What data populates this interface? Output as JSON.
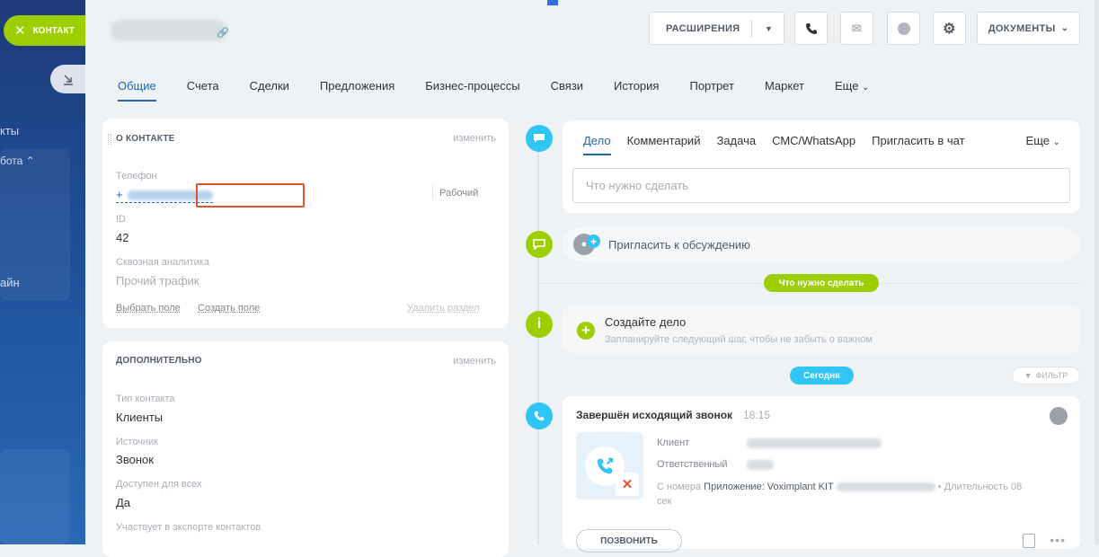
{
  "sidebar": {
    "chip_label": "КОНТАКТ",
    "partial_items": [
      "кты",
      "бота",
      "айн"
    ]
  },
  "header": {
    "extensions_label": "РАСШИРЕНИЯ",
    "documents_label": "ДОКУМЕНТЫ"
  },
  "tabs": [
    "Общие",
    "Счета",
    "Сделки",
    "Предложения",
    "Бизнес-процессы",
    "Связи",
    "История",
    "Портрет",
    "Маркет",
    "Еще"
  ],
  "about": {
    "title": "О КОНТАКТЕ",
    "edit": "изменить",
    "phone_label": "Телефон",
    "phone_prefix": "+",
    "phone_type": "Рабочий",
    "id_label": "ID",
    "id_value": "42",
    "analytics_label": "Сквозная аналитика",
    "analytics_value": "Прочий трафик",
    "select_field": "Выбрать поле",
    "create_field": "Создать поле",
    "delete_section": "Удалить раздел"
  },
  "extra": {
    "title": "ДОПОЛНИТЕЛЬНО",
    "edit": "изменить",
    "type_label": "Тип контакта",
    "type_value": "Клиенты",
    "source_label": "Источник",
    "source_value": "Звонок",
    "avail_label": "Доступен для всех",
    "avail_value": "Да",
    "export_label": "Участвует в экспорте контактов"
  },
  "editor": {
    "tabs": [
      "Дело",
      "Комментарий",
      "Задача",
      "СМС/WhatsApp",
      "Пригласить в чат"
    ],
    "more": "Еще",
    "placeholder": "Что нужно сделать"
  },
  "invite": "Пригласить к обсуждению",
  "todo_pill": "Что нужно сделать",
  "create_task": {
    "title": "Создайте дело",
    "subtitle": "Запланируйте следующий шаг, чтобы не забыть о важном"
  },
  "today_pill": "Сегодня",
  "filter": "ФИЛЬТР",
  "call": {
    "title": "Завершён исходящий звонок",
    "time": "18:15",
    "client_label": "Клиент",
    "resp_label": "Ответственный",
    "from_label": "С номера",
    "app": "Приложение: Voximplant KIT",
    "duration": "• Длительность 08",
    "duration_unit": "сек",
    "call_button": "ПОЗВОНИТЬ"
  },
  "colors": {
    "accent": "#2067b0",
    "green": "#9dcf00",
    "blue": "#2fc6f6",
    "red_box": "#e2532b"
  }
}
